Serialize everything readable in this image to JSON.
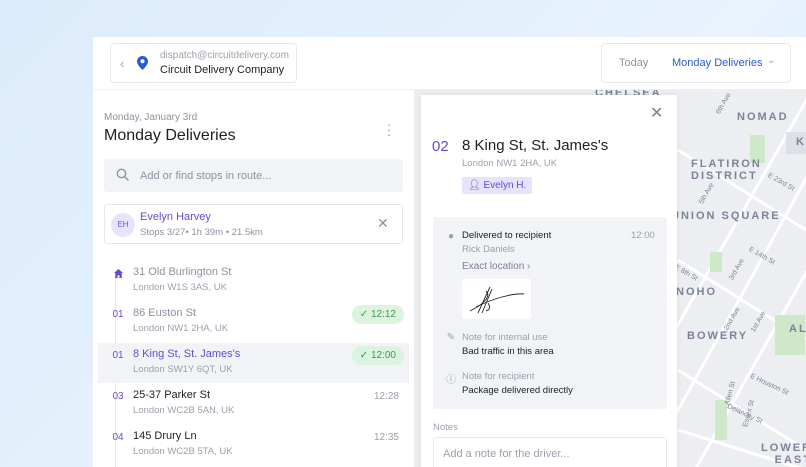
{
  "header": {
    "account_email": "dispatch@circuitdelivery.com",
    "company": "Circuit Delivery Company",
    "today_label": "Today",
    "route_selected": "Monday Deliveries"
  },
  "route": {
    "date": "Monday, January 3rd",
    "title": "Monday Deliveries",
    "search_placeholder": "Add or find stops in route...",
    "driver": {
      "initials": "EH",
      "name": "Evelyn Harvey",
      "stats": "Stops 3/27• 1h 39m • 21.5km"
    },
    "stops": [
      {
        "num": "",
        "address": "31 Old Burlington St",
        "zip": "London W1S 3AS, UK",
        "time": "",
        "status": "depot"
      },
      {
        "num": "01",
        "address": "86 Euston St",
        "zip": "London NW1 2HA, UK",
        "time": "12:12",
        "status": "done"
      },
      {
        "num": "01",
        "address": "8 King St, St. James's",
        "zip": "London SW1Y 6QT, UK",
        "time": "12:00",
        "status": "selected"
      },
      {
        "num": "03",
        "address": "25-37 Parker St",
        "zip": "London WC2B 5AN, UK",
        "time": "12:28",
        "status": "pending"
      },
      {
        "num": "04",
        "address": "145 Drury Ln",
        "zip": "London WC2B 5TA, UK",
        "time": "12:35",
        "status": "pending"
      }
    ]
  },
  "detail": {
    "number": "02",
    "title": "8 King St, St. James's",
    "zip": "London NW1 2HA, UK",
    "driver_chip": "Evelyn H.",
    "delivered_label": "Delivered to recipient",
    "recipient": "Rick Daniels",
    "time": "12:00",
    "exact_location": "Exact location",
    "internal_label": "Note for internal use",
    "internal_note": "Bad traffic in this area",
    "recipient_label": "Note for recipient",
    "recipient_note": "Package delivered directly",
    "notes_label": "Notes",
    "notes_placeholder": "Add a note for the driver..."
  },
  "map": {
    "areas": [
      "CHELSEA",
      "NOMAD",
      "KIPS",
      "FLATIRON DISTRICT",
      "UNION SQUARE",
      "NOHO",
      "BOWERY",
      "ALPH",
      "LOWER EAST SIDE"
    ],
    "streets": [
      "6th Ave",
      "E 23rd St",
      "5th Ave",
      "E 14th St",
      "3rd Ave",
      "E 8th St",
      "2nd Ave",
      "1st Ave",
      "E Houston St",
      "Allen St",
      "Essex St",
      "Delancey St"
    ]
  },
  "colors": {
    "accent": "#5b4fd6",
    "link": "#2a5bd7",
    "success": "#3f9a4f"
  }
}
